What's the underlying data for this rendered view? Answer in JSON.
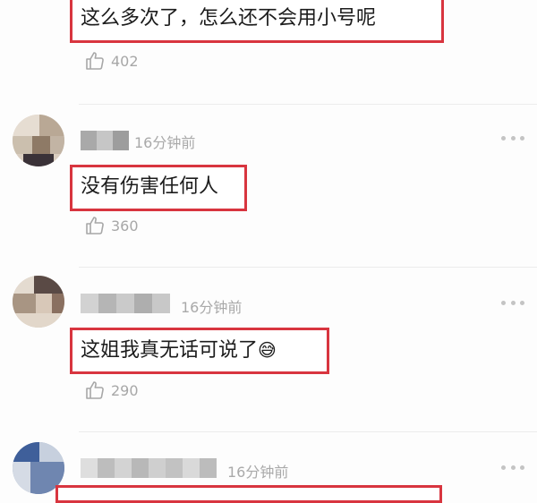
{
  "comments": [
    {
      "text": "这么多次了，怎么还不会用小号呢",
      "likes": "402",
      "like_icon": "thumbs-up-icon"
    },
    {
      "time": "16分钟前",
      "text": "没有伤害任何人",
      "likes": "360",
      "like_icon": "thumbs-up-icon",
      "more_icon": "more-icon"
    },
    {
      "time": "16分钟前",
      "text": "这姐我真无话可说了",
      "emoji": "😅",
      "likes": "290",
      "like_icon": "thumbs-up-icon",
      "more_icon": "more-icon"
    },
    {
      "time": "16分钟前",
      "more_icon": "more-icon"
    }
  ],
  "colors": {
    "highlight": "#d8353f",
    "muted": "#a9a9a9"
  }
}
